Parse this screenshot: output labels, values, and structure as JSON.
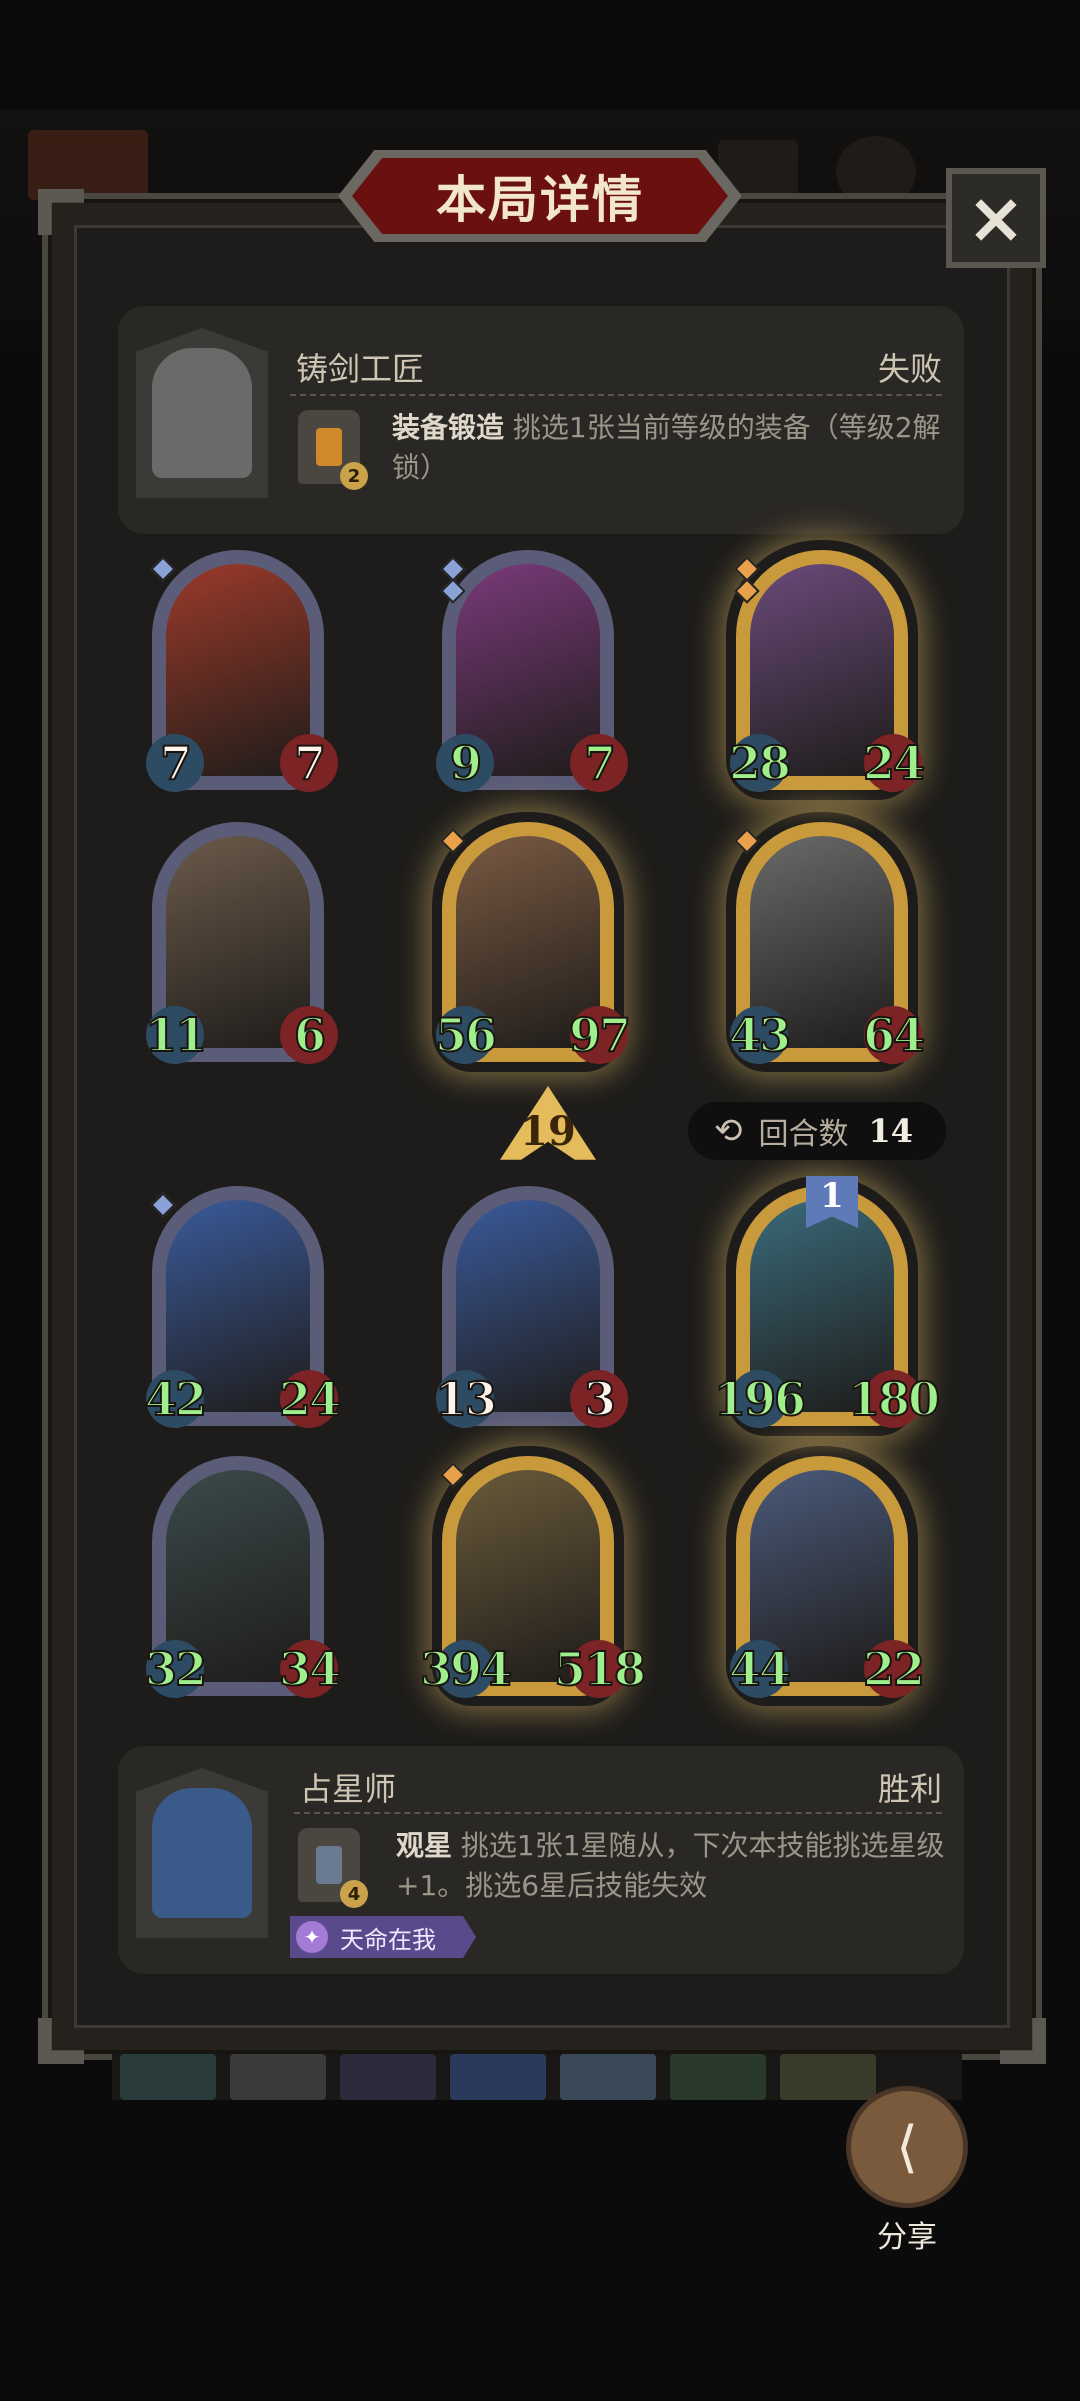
{
  "title": "本局详情",
  "close_icon": "×",
  "top_hero": {
    "name": "铸剑工匠",
    "result": "失败",
    "skill_level": "2",
    "skill_name": "装备锻造",
    "skill_desc": "挑选1张当前等级的装备（等级2解锁）"
  },
  "cards": [
    {
      "attack": "7",
      "health": "7",
      "art_color": "#9b3a2a",
      "frame": "silver",
      "tier": 1
    },
    {
      "attack": "9",
      "health": "7",
      "art_color": "#7a3a7a",
      "frame": "silver",
      "tier": 2
    },
    {
      "attack": "28",
      "health": "24",
      "art_color": "#6a4a7a",
      "frame": "gold",
      "tier": 2
    },
    {
      "attack": "11",
      "health": "6",
      "art_color": "#6b5a4a",
      "frame": "silver",
      "tier": 0
    },
    {
      "attack": "56",
      "health": "97",
      "art_color": "#7a5a42",
      "frame": "gold",
      "tier": 1
    },
    {
      "attack": "43",
      "health": "64",
      "art_color": "#6a6a6a",
      "frame": "gold",
      "tier": 1
    },
    {
      "attack": "42",
      "health": "24",
      "art_color": "#3a5a9a",
      "frame": "silver",
      "tier": 1
    },
    {
      "attack": "13",
      "health": "3",
      "art_color": "#3a5a9a",
      "frame": "silver",
      "tier": 0
    },
    {
      "attack": "196",
      "health": "180",
      "art_color": "#3a6a7a",
      "frame": "gold",
      "tier": 0
    },
    {
      "attack": "32",
      "health": "34",
      "art_color": "#3a4a4a",
      "frame": "silver",
      "tier": 0
    },
    {
      "attack": "394",
      "health": "518",
      "art_color": "#6a5a3a",
      "frame": "gold",
      "tier": 1
    },
    {
      "attack": "44",
      "health": "22",
      "art_color": "#4a5a7a",
      "frame": "gold",
      "tier": 0
    }
  ],
  "level": "19",
  "rounds": {
    "label": "回合数",
    "value": "14",
    "icon": "refresh-icon"
  },
  "star_badge": "1",
  "bottom_hero": {
    "name": "占星师",
    "result": "胜利",
    "skill_level": "4",
    "skill_name": "观星",
    "skill_desc": "挑选1张1星随从，下次本技能挑选星级+1。挑选6星后技能失效",
    "trait": "天命在我"
  },
  "share_label": "分享",
  "colors": {
    "gold_frame": "#c99a3c",
    "silver_frame": "#5a5c78",
    "accent_red": "#6a1010"
  }
}
